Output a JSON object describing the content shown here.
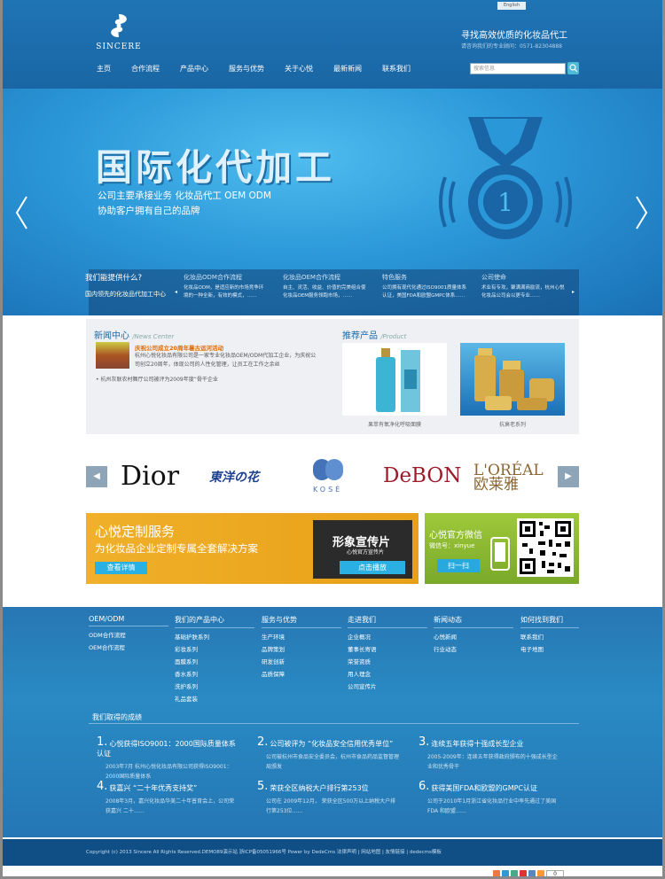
{
  "header": {
    "logo_text": "SINCERE",
    "english_label": "English",
    "slogan": "寻找高效优质的化妆品代工",
    "phone": "请咨询我们的专业顾问：0571-82304888",
    "search_placeholder": "搜索信息",
    "nav": [
      "主页",
      "合作流程",
      "产品中心",
      "服务与优势",
      "关于心悦",
      "最新新闻",
      "联系我们"
    ]
  },
  "banner": {
    "title": "国际化代加工",
    "sub1": "公司主要承接业务 化妆品代工 OEM ODM",
    "sub2": "协助客户拥有自己的品牌",
    "medal_number": "1",
    "info_question": "我们能提供什么?",
    "info_answer": "国内领先的化妆品代加工中心",
    "cols": [
      {
        "h": "化妆品ODM合作流程",
        "d": "化妆品ODM，是适应新的市场竞争环境的一种全新，有效的模式，……"
      },
      {
        "h": "化妆品OEM合作流程",
        "d": "自主、灵活、收益、价值的完美组合使化妆品OEM服务领跑市场，……"
      },
      {
        "h": "特色服务",
        "d": "公司拥有现代化通过ISO9001质量体系认证，美国FDA和欧盟GMPC体系……"
      },
      {
        "h": "公司使命",
        "d": "术业有专攻，聚满满商励流，杭州心悦化妆品公司会以更专业……"
      }
    ]
  },
  "news": {
    "title": "新闻中心",
    "title_en": "/News Center",
    "headline": "庆祝公司成立20周年暑古运河活动",
    "desc": "杭州心悦化妆品有限公司是一家专业化妆品OEM/ODM代加工企业，为庆祝公司创立20周年，体现公司的人性化管理，让员工在工作之余丝",
    "item": "• 杭州灰联农村舞厅公司被评为2009年度“骨干企业"
  },
  "products": {
    "title": "推荐产品",
    "title_en": "/Product",
    "items": [
      "果萃有氧净化呼吸面膜",
      "抗衰老系列"
    ]
  },
  "brands": [
    "Dior",
    "東洋の花",
    "KOSÉ",
    "DeBON",
    "L'ORÉAL 欧莱雅"
  ],
  "ad1": {
    "title": "心悦定制服务",
    "sub": "为化妆品企业定制专属全套解决方案",
    "button": "查看详情",
    "film_title": "形象宣传片",
    "film_sub": "心悦官方宣传片",
    "film_button": "点击播放"
  },
  "ad2": {
    "title": "心悦官方微信",
    "sub": "微信号：xinyue",
    "button": "扫一扫"
  },
  "footer": {
    "cols": [
      {
        "h": "OEM/ODM",
        "links": [
          "ODM合作流程",
          "OEM合作流程"
        ]
      },
      {
        "h": "我们的产品中心",
        "links": [
          "基础护肤系列",
          "彩妆系列",
          "面膜系列",
          "香水系列",
          "洗护系列",
          "礼品套装"
        ]
      },
      {
        "h": "服务与优势",
        "links": [
          "生产环境",
          "品牌策划",
          "研发创新",
          "品质保障"
        ]
      },
      {
        "h": "走进我们",
        "links": [
          "企业概况",
          "董事长寄语",
          "荣誉资质",
          "用人理念",
          "公司宣传片"
        ]
      },
      {
        "h": "新闻动态",
        "links": [
          "心悦新闻",
          "行业动态"
        ]
      },
      {
        "h": "如何找到我们",
        "links": [
          "联系我们",
          "电子地图"
        ]
      }
    ],
    "ach_title": "我们取得的成绩",
    "achievements": [
      {
        "n": "1.",
        "h": "心悦获得ISO9001：2000国际质量体系认证",
        "d": "2003年7月 杭州心悦化妆品有限公司获得ISO9001：2000国际质量体系"
      },
      {
        "n": "2.",
        "h": "公司被评为 “化妆品安全信用优秀单位”",
        "d": "公司被杭州市食品安全委员会，杭州市食品药品监督管理局颁发"
      },
      {
        "n": "3.",
        "h": "连续五年获得十强成长型企业",
        "d": "2005-2009年：连续五年获得政府颁布的十强成长型企业和优秀骨干"
      },
      {
        "n": "4.",
        "h": "获嘉兴 “二十年优秀支持奖”",
        "d": "2008年3月，嘉兴化妆品华美二十年普育会上，公司荣获嘉兴 二十……"
      },
      {
        "n": "5.",
        "h": "荣获全区纳税大户排行第253位",
        "d": "公司在 2009年12月， 荣获全区500万以上纳税大户排行第253位……"
      },
      {
        "n": "6.",
        "h": "获得美国FDA和欧盟的GMPC认证",
        "d": "公司于2010年1月浙江省化妆品行业中率先通过了美国 FDA 和欧盟……"
      }
    ],
    "copyright": "Copyright (c) 2013 Sincere All Rights Reserved.DEMO89演示站 浙ICP备05051966号 Power by DedeCms 法律声明 | 网站地图 | 友情链接 | dedecms模板",
    "share_count": "0"
  }
}
